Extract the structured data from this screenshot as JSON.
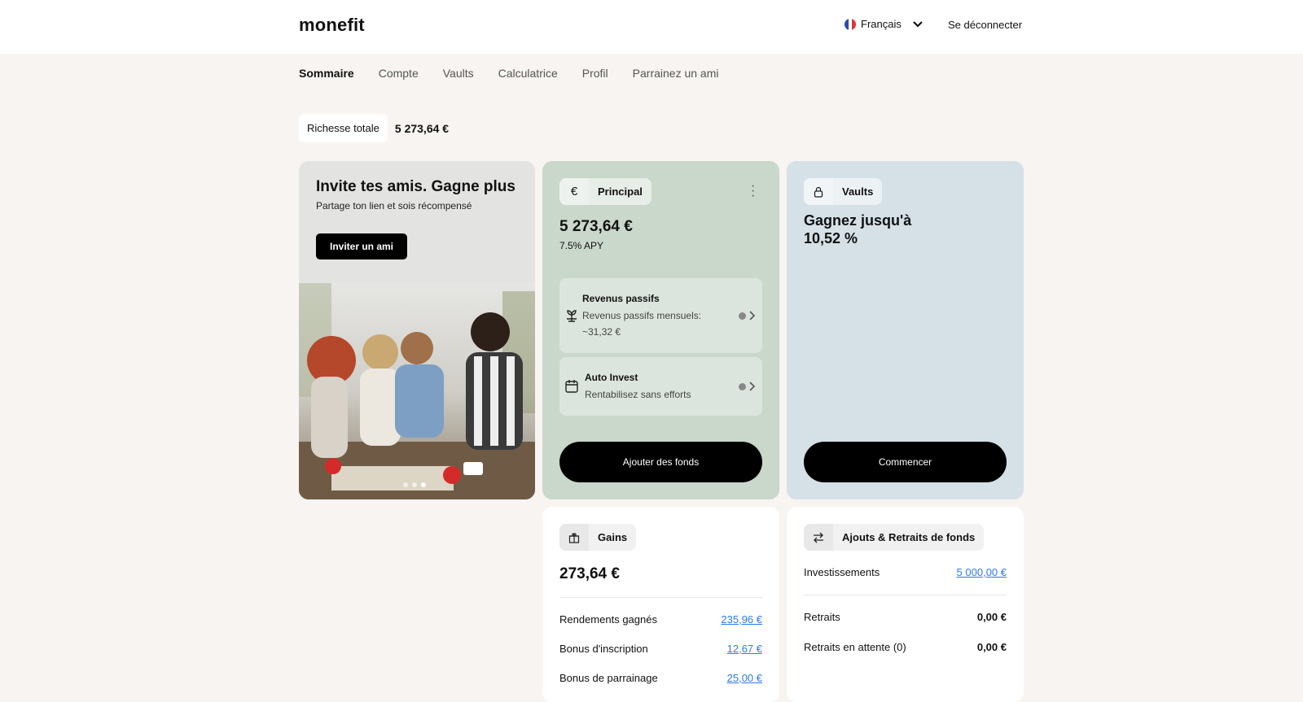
{
  "header": {
    "logo": "monefit",
    "language": "Français",
    "logout": "Se déconnecter"
  },
  "nav": {
    "items": [
      "Sommaire",
      "Compte",
      "Vaults",
      "Calculatrice",
      "Profil",
      "Parrainez un ami"
    ]
  },
  "wealth": {
    "label": "Richesse totale",
    "value": "5 273,64 €"
  },
  "invite": {
    "title": "Invite tes amis. Gagne plus",
    "subtitle": "Partage ton lien et sois récompensé",
    "button": "Inviter un ami"
  },
  "principal": {
    "icon": "€",
    "label": "Principal",
    "balance": "5 273,64 €",
    "apy": "7.5% APY",
    "passive": {
      "title": "Revenus passifs",
      "line1": "Revenus passifs mensuels:",
      "line2": "~31,32 €"
    },
    "autoinvest": {
      "title": "Auto Invest",
      "subtitle": "Rentabilisez sans efforts"
    },
    "button": "Ajouter des fonds"
  },
  "vaults": {
    "label": "Vaults",
    "line1": "Gagnez jusqu'à",
    "line2": "10,52 %",
    "button": "Commencer"
  },
  "gains": {
    "label": "Gains",
    "total": "273,64 €",
    "rows": [
      {
        "label": "Rendements gagnés",
        "value": "235,96 €"
      },
      {
        "label": "Bonus d'inscription",
        "value": "12,67 €"
      },
      {
        "label": "Bonus de parrainage",
        "value": "25,00 €"
      }
    ]
  },
  "funds": {
    "label": "Ajouts & Retraits de fonds",
    "investments": {
      "label": "Investissements",
      "value": "5 000,00 €"
    },
    "withdrawals": {
      "label": "Retraits",
      "value": "0,00 €"
    },
    "pending": {
      "label": "Retraits en attente (0)",
      "value": "0,00 €"
    }
  }
}
